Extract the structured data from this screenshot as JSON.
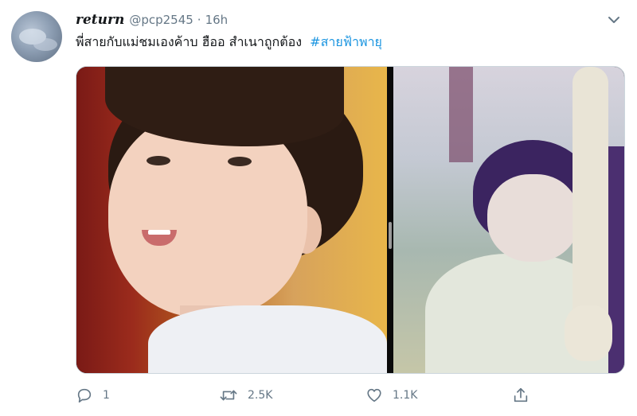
{
  "tweet": {
    "display_name": "return",
    "handle": "@pcp2545",
    "separator": "·",
    "time": "16h",
    "text_main": "พี่สายกับแม่ชมเองค้าบ ฮืออ สำเนาถูกต้อง",
    "hashtag": "#สายฟ้าพายุ",
    "replies": "1",
    "retweets": "2.5K",
    "likes": "1.1K"
  },
  "icons": {
    "caret": "chevron-down-icon",
    "reply": "reply-icon",
    "retweet": "retweet-icon",
    "like": "heart-icon",
    "share": "share-icon"
  },
  "colors": {
    "text_primary": "#14171a",
    "text_secondary": "#657786",
    "link": "#1b95e0",
    "border": "#ccd6dd"
  }
}
